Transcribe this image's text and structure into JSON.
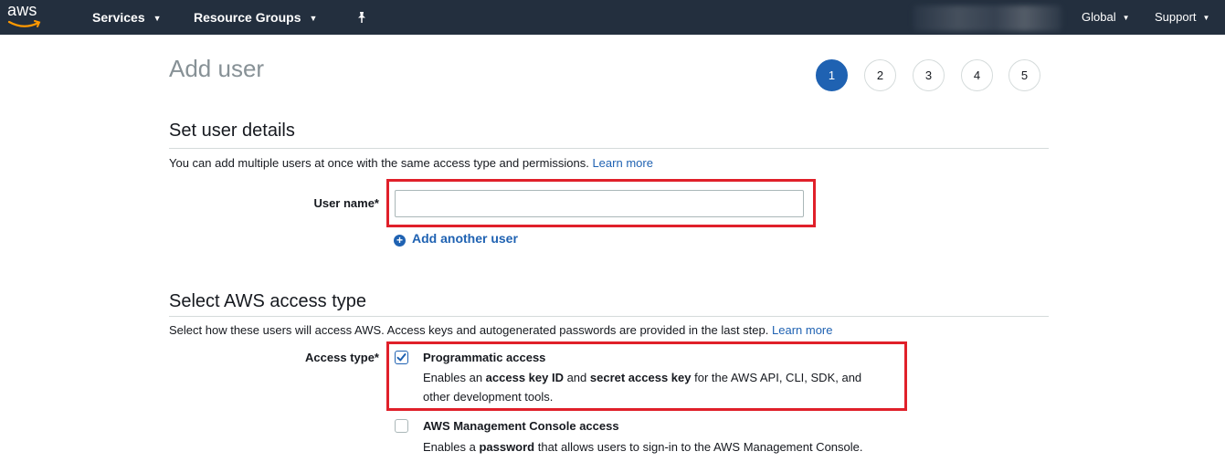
{
  "topnav": {
    "logo": "aws",
    "services": "Services",
    "resource_groups": "Resource Groups",
    "pin_icon": "pin-icon",
    "region": "Global",
    "support": "Support"
  },
  "page": {
    "title": "Add user",
    "steps": [
      "1",
      "2",
      "3",
      "4",
      "5"
    ],
    "active_step": "1"
  },
  "user_details": {
    "title": "Set user details",
    "description": "You can add multiple users at once with the same access type and permissions.",
    "learn_more": "Learn more",
    "username_label": "User name*",
    "username_value": "",
    "add_another": "Add another user"
  },
  "access_type": {
    "title": "Select AWS access type",
    "description": "Select how these users will access AWS. Access keys and autogenerated passwords are provided in the last step.",
    "learn_more": "Learn more",
    "label": "Access type*",
    "programmatic": {
      "title": "Programmatic access",
      "checked": true,
      "desc_1": "Enables an ",
      "desc_b1": "access key ID",
      "desc_2": " and ",
      "desc_b2": "secret access key",
      "desc_3": " for the AWS API, CLI, SDK, and",
      "desc_4": "other development tools."
    },
    "console": {
      "title": "AWS Management Console access",
      "checked": false,
      "desc_1": "Enables a ",
      "desc_b1": "password",
      "desc_2": " that allows users to sign-in to the AWS Management Console."
    }
  },
  "colors": {
    "nav_bg": "#232f3e",
    "link": "#1f62b2",
    "highlight": "#e0202a",
    "active_step": "#1f62b2"
  }
}
